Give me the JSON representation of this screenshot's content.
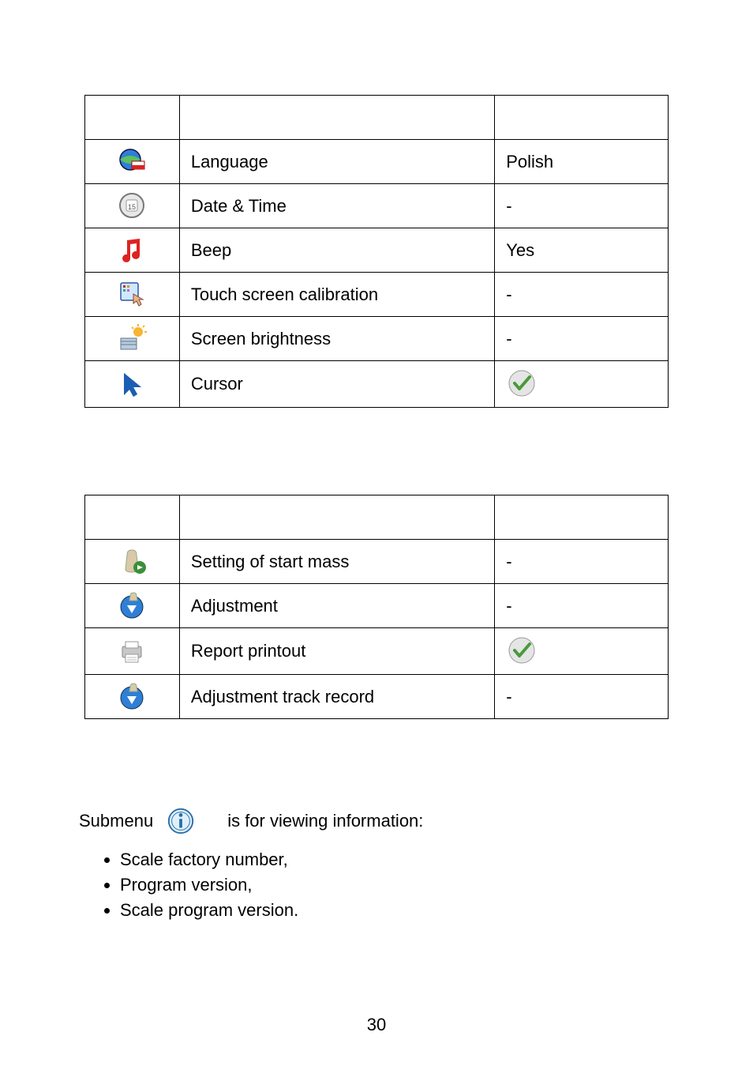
{
  "table1": {
    "rows": [
      {
        "icon": "globe-flag-icon",
        "label": "Language",
        "value": "Polish",
        "value_is_icon": false
      },
      {
        "icon": "clock-icon",
        "label": "Date & Time",
        "value": "-",
        "value_is_icon": false
      },
      {
        "icon": "music-note-icon",
        "label": "Beep",
        "value": "Yes",
        "value_is_icon": false
      },
      {
        "icon": "touch-screen-icon",
        "label": "Touch screen calibration",
        "value": "-",
        "value_is_icon": false
      },
      {
        "icon": "brightness-icon",
        "label": "Screen brightness",
        "value": "-",
        "value_is_icon": false
      },
      {
        "icon": "cursor-arrow-icon",
        "label": "Cursor",
        "value": "checkmark-icon",
        "value_is_icon": true
      }
    ]
  },
  "table2": {
    "rows": [
      {
        "icon": "start-mass-icon",
        "label": "Setting of start mass",
        "value": "-",
        "value_is_icon": false
      },
      {
        "icon": "adjustment-icon",
        "label": "Adjustment",
        "value": "-",
        "value_is_icon": false
      },
      {
        "icon": "printer-icon",
        "label": "Report printout",
        "value": "checkmark-icon",
        "value_is_icon": true
      },
      {
        "icon": "track-record-icon",
        "label": "Adjustment track record",
        "value": "-",
        "value_is_icon": false
      }
    ]
  },
  "submenu": {
    "prefix": "Submenu",
    "suffix": "is for viewing information:",
    "icon": "info-icon",
    "items": [
      "Scale factory number,",
      "Program version,",
      "Scale program version."
    ]
  },
  "page_number": "30"
}
